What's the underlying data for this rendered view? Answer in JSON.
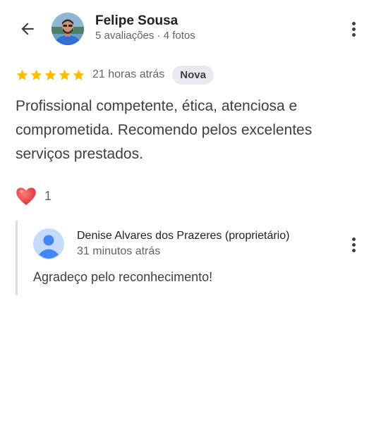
{
  "header": {
    "back_icon": "arrow-left-icon",
    "author_name": "Felipe Sousa",
    "author_meta": "5 avaliações · 4 fotos",
    "menu_icon": "more-vertical-icon"
  },
  "review": {
    "rating": 5,
    "rating_max": 5,
    "star_color": "#fbbc04",
    "time": "21 horas atrás",
    "badge": "Nova",
    "text": "Profissional competente, ética, atenciosa e comprometida. Recomendo pelos excelentes serviços prestados."
  },
  "reaction": {
    "icon": "heart-icon",
    "color": "#e8453c",
    "count": "1"
  },
  "owner_reply": {
    "name": "Denise Alvares dos Prazeres (proprietário)",
    "time": "31 minutos atrás",
    "text": "Agradeço pelo reconhecimento!",
    "avatar_icon": "person-icon",
    "avatar_color": "#4285f4",
    "menu_icon": "more-vertical-icon"
  }
}
